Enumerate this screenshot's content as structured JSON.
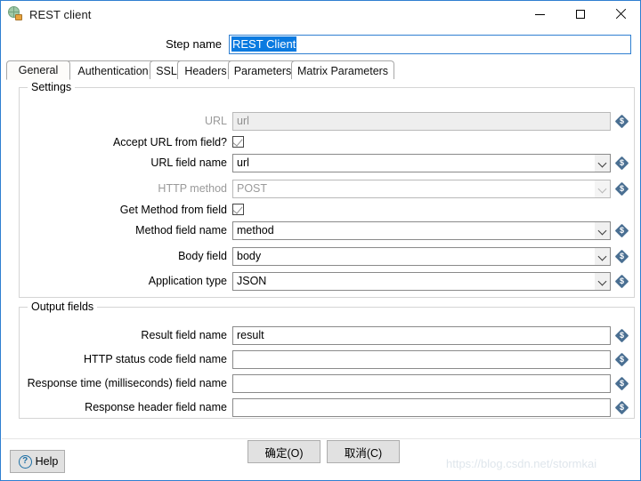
{
  "window": {
    "title": "REST client",
    "icon": "globe-rest-icon",
    "controls": {
      "minimize": "minimize-icon",
      "maximize": "maximize-icon",
      "close": "close-icon"
    }
  },
  "step_name": {
    "label": "Step name",
    "value": "REST Client",
    "selected": true
  },
  "tabs": [
    {
      "label": "General",
      "active": true
    },
    {
      "label": "Authentication",
      "active": false
    },
    {
      "label": "SSL",
      "active": false
    },
    {
      "label": "Headers",
      "active": false
    },
    {
      "label": "Parameters",
      "active": false
    },
    {
      "label": "Matrix Parameters",
      "active": false
    }
  ],
  "settings_group": {
    "title": "Settings",
    "rows": {
      "url": {
        "label": "URL",
        "value": "url",
        "disabled": true
      },
      "accept_url_from_field": {
        "label": "Accept URL from field?",
        "checked": true
      },
      "url_field_name": {
        "label": "URL field name",
        "value": "url",
        "disabled": false
      },
      "http_method": {
        "label": "HTTP method",
        "value": "POST",
        "disabled": true
      },
      "get_method_from_field": {
        "label": "Get Method from field",
        "checked": true
      },
      "method_field_name": {
        "label": "Method field name",
        "value": "method",
        "disabled": false
      },
      "body_field": {
        "label": "Body field",
        "value": "body",
        "disabled": false
      },
      "application_type": {
        "label": "Application type",
        "value": "JSON",
        "disabled": false
      }
    }
  },
  "output_group": {
    "title": "Output fields",
    "rows": {
      "result_field_name": {
        "label": "Result field name",
        "value": "result"
      },
      "http_status_code_field_name": {
        "label": "HTTP status code field name",
        "value": ""
      },
      "response_time_field_name": {
        "label": "Response time (milliseconds) field name",
        "value": ""
      },
      "response_header_field_name": {
        "label": "Response header field name",
        "value": ""
      }
    }
  },
  "variable_icon": {
    "name": "dollar-variable-icon",
    "glyph": "$",
    "color": "#4a6f92"
  },
  "footer": {
    "help_label": "Help",
    "help_icon": "question-mark-icon",
    "ok_label": "确定(O)",
    "ok_mnemonic": "O",
    "cancel_label": "取消(C)",
    "cancel_mnemonic": "C"
  },
  "watermark": "https://blog.csdn.net/stormkai"
}
